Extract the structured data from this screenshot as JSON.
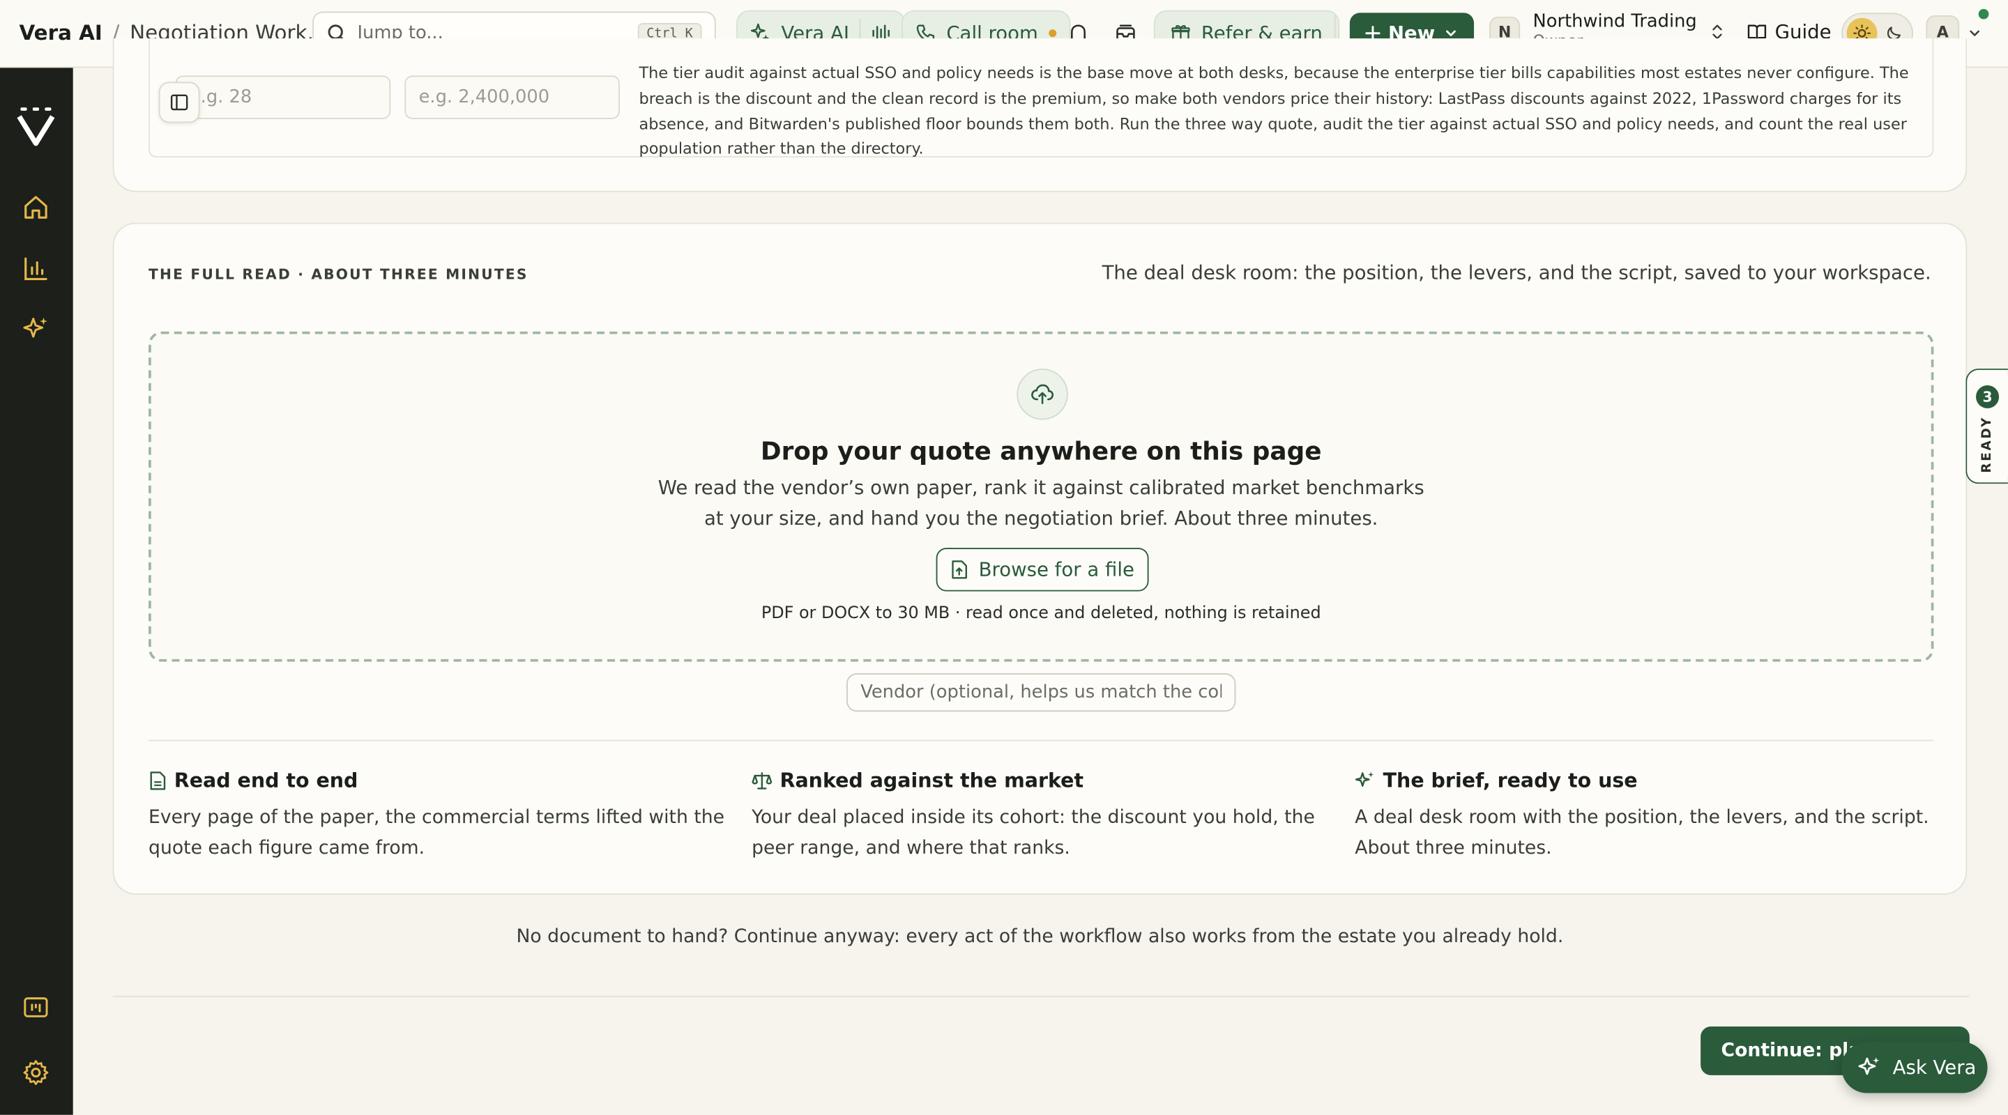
{
  "header": {
    "app_name": "Vera AI",
    "separator": "/",
    "page_title": "Negotiation Work...",
    "search_placeholder": "Jump to...",
    "search_shortcut": "Ctrl K",
    "vera_ai_label": "Vera AI",
    "call_room_label": "Call room",
    "refer_label": "Refer & earn",
    "new_label": "New",
    "org_initial": "N",
    "org_name": "Northwind Trading",
    "org_role": "Owner",
    "guide_label": "Guide",
    "user_initial": "A"
  },
  "sidebar": {
    "icons": [
      "vera-logo-icon",
      "home-icon",
      "chart-icon",
      "sparkle-icon",
      "folder-icon",
      "gear-icon"
    ]
  },
  "estate_form": {
    "seats_placeholder": "e.g. 28",
    "spend_placeholder": "e.g. 2,400,000",
    "audit_text": "The tier audit against actual SSO and policy needs is the base move at both desks, because the enterprise tier bills capabilities most estates never configure. The breach is the discount and the clean record is the premium, so make both vendors price their history: LastPass discounts against 2022, 1Password charges for its absence, and Bitwarden's published floor bounds them both. Run the three way quote, audit the tier against actual SSO and policy needs, and count the real user population rather than the directory."
  },
  "upload": {
    "eyebrow": "THE FULL READ · ABOUT THREE MINUTES",
    "tagline": "The deal desk room: the position, the levers, and the script, saved to your workspace.",
    "title": "Drop your quote anywhere on this page",
    "subtitle_line1": "We read the vendor’s own paper, rank it against calibrated market benchmarks",
    "subtitle_line2": "at your size, and hand you the negotiation brief. About three minutes.",
    "browse_label": "Browse for a file",
    "note": "PDF or DOCX to 30 MB · read once and deleted, nothing is retained",
    "vendor_placeholder": "Vendor (optional, helps us match the cohort)"
  },
  "features": [
    {
      "title": "Read end to end",
      "body": "Every page of the paper, the commercial terms lifted with the quote each figure came from."
    },
    {
      "title": "Ranked against the market",
      "body": "Your deal placed inside its cohort: the discount you hold, the peer range, and where that ranks."
    },
    {
      "title": "The brief, ready to use",
      "body": "A deal desk room with the position, the levers, and the script. About three minutes."
    }
  ],
  "footer": {
    "no_document": "No document to hand? Continue anyway: every act of the workflow also works from the estate you already hold.",
    "continue_label": "Continue: plan t",
    "ask_vera_label": "Ask Vera"
  },
  "ready_tab": {
    "count": "3",
    "label": "READY"
  },
  "colors": {
    "accent": "#2a5b3b",
    "rail": "#1c1f1a",
    "background": "#f6f4ec",
    "status_dot": "#d9a02c"
  }
}
